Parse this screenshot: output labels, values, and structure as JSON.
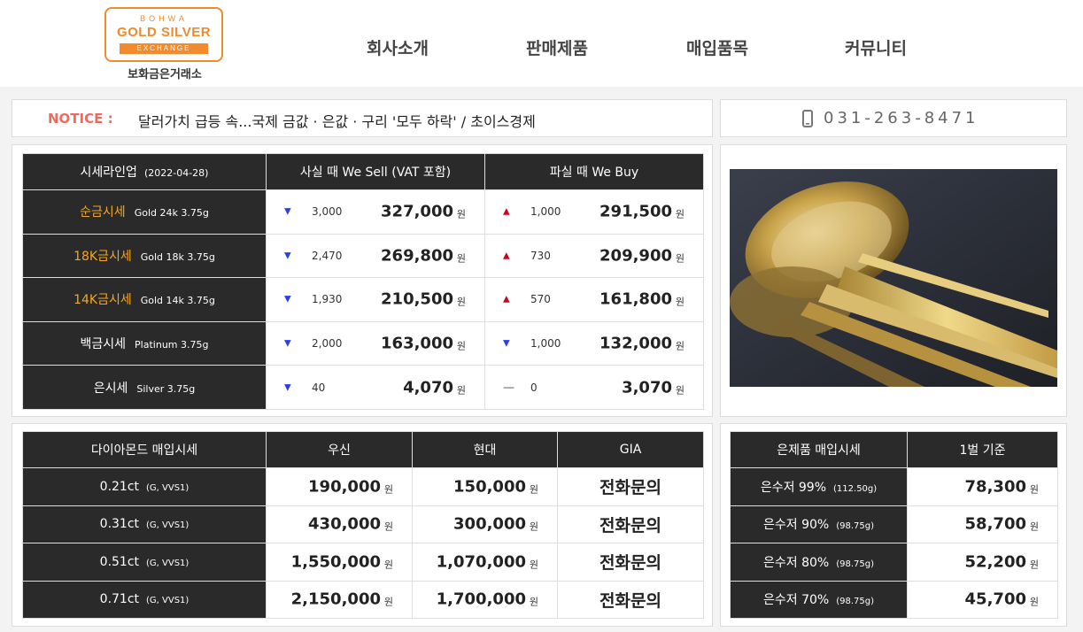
{
  "header": {
    "logo": {
      "top": "BOHWA",
      "main": "GOLD SILVER",
      "sub": "EXCHANGE",
      "korean": "보화금은거래소"
    },
    "nav": [
      "회사소개",
      "판매제품",
      "매입품목",
      "커뮤니티"
    ]
  },
  "notice": {
    "label": "NOTICE :",
    "text": "달러가치 급등 속...국제 금값 · 은값 · 구리 '모두 하락' / 초이스경제"
  },
  "phone": {
    "number": "031-263-8471",
    "icon": "phone-icon"
  },
  "price_table": {
    "header": {
      "title": "시세라인업",
      "date": "(2022-04-28)",
      "sell": "사실 때 We Sell (VAT 포함)",
      "buy": "파실 때 We Buy"
    },
    "unit": "원",
    "rows": [
      {
        "name": "순금시세",
        "spec": "Gold 24k 3.75g",
        "gold": true,
        "sell_dir": "down",
        "sell_change": "3,000",
        "sell_price": "327,000",
        "buy_dir": "up",
        "buy_change": "1,000",
        "buy_price": "291,500"
      },
      {
        "name": "18K금시세",
        "spec": "Gold 18k 3.75g",
        "gold": true,
        "sell_dir": "down",
        "sell_change": "2,470",
        "sell_price": "269,800",
        "buy_dir": "up",
        "buy_change": "730",
        "buy_price": "209,900"
      },
      {
        "name": "14K금시세",
        "spec": "Gold 14k 3.75g",
        "gold": true,
        "sell_dir": "down",
        "sell_change": "1,930",
        "sell_price": "210,500",
        "buy_dir": "up",
        "buy_change": "570",
        "buy_price": "161,800"
      },
      {
        "name": "백금시세",
        "spec": "Platinum 3.75g",
        "gold": false,
        "sell_dir": "down",
        "sell_change": "2,000",
        "sell_price": "163,000",
        "buy_dir": "down",
        "buy_change": "1,000",
        "buy_price": "132,000"
      },
      {
        "name": "은시세",
        "spec": "Silver 3.75g",
        "gold": false,
        "sell_dir": "down",
        "sell_change": "40",
        "sell_price": "4,070",
        "buy_dir": "flat",
        "buy_change": "0",
        "buy_price": "3,070"
      }
    ],
    "colors": {
      "down": "#2c3ee8",
      "up": "#d0021b",
      "gold_text": "#f5a623",
      "header_bg": "#2a2a2a"
    }
  },
  "diamond_table": {
    "headers": [
      "다이아몬드 매입시세",
      "우신",
      "현대",
      "GIA"
    ],
    "unit": "원",
    "rows": [
      {
        "carat": "0.21ct",
        "grade": "(G, VVS1)",
        "wooshin": "190,000",
        "hyundai": "150,000",
        "gia": "전화문의"
      },
      {
        "carat": "0.31ct",
        "grade": "(G, VVS1)",
        "wooshin": "430,000",
        "hyundai": "300,000",
        "gia": "전화문의"
      },
      {
        "carat": "0.51ct",
        "grade": "(G, VVS1)",
        "wooshin": "1,550,000",
        "hyundai": "1,070,000",
        "gia": "전화문의"
      },
      {
        "carat": "0.71ct",
        "grade": "(G, VVS1)",
        "wooshin": "2,150,000",
        "hyundai": "1,700,000",
        "gia": "전화문의"
      }
    ]
  },
  "silver_table": {
    "headers": [
      "은제품 매입시세",
      "1벌 기준"
    ],
    "unit": "원",
    "rows": [
      {
        "name": "은수저 99%",
        "weight": "(112.50g)",
        "price": "78,300"
      },
      {
        "name": "은수저 90%",
        "weight": "(98.75g)",
        "price": "58,700"
      },
      {
        "name": "은수저 80%",
        "weight": "(98.75g)",
        "price": "52,200"
      },
      {
        "name": "은수저 70%",
        "weight": "(98.75g)",
        "price": "45,700"
      }
    ]
  }
}
